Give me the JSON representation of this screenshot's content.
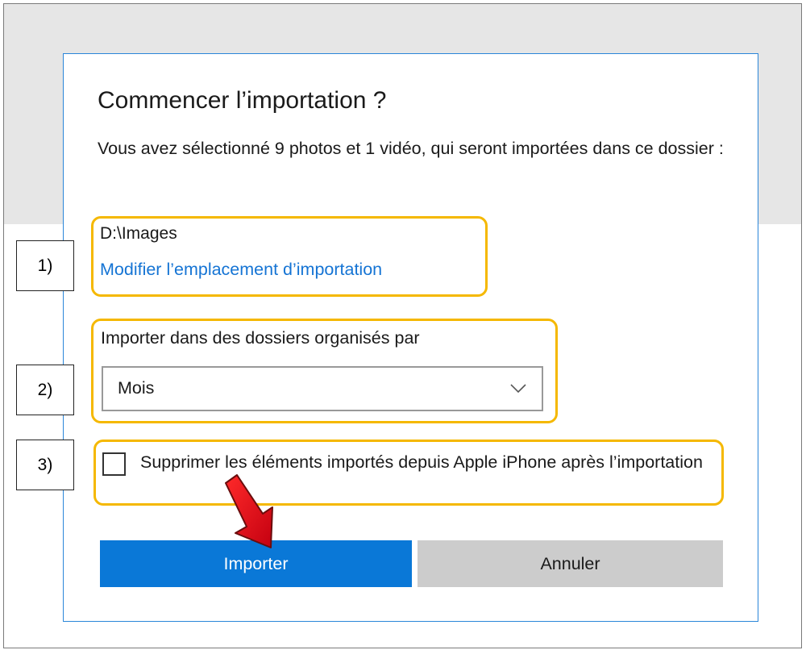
{
  "dialog": {
    "title": "Commencer l’importation ?",
    "description": "Vous avez sélectionné 9 photos et 1 vidéo, qui seront importées dans ce dossier :"
  },
  "location": {
    "path": "D:\\Images",
    "change_link": "Modifier l’emplacement d’importation"
  },
  "organize": {
    "label": "Importer dans des dossiers organisés par",
    "selected": "Mois",
    "chevron_icon": "chevron-down-icon"
  },
  "delete_option": {
    "label": "Supprimer les éléments importés depuis Apple iPhone après l’importation",
    "checked": false
  },
  "buttons": {
    "import": "Importer",
    "cancel": "Annuler"
  },
  "annotations": {
    "markers": [
      "1)",
      "2)",
      "3)"
    ],
    "highlight_color": "#f5b800",
    "arrow_color": "#e8141b",
    "arrow_icon": "red-arrow-icon"
  },
  "colors": {
    "accent": "#0a78d7",
    "link": "#1574d4",
    "dialog_border": "#2b86d9"
  }
}
